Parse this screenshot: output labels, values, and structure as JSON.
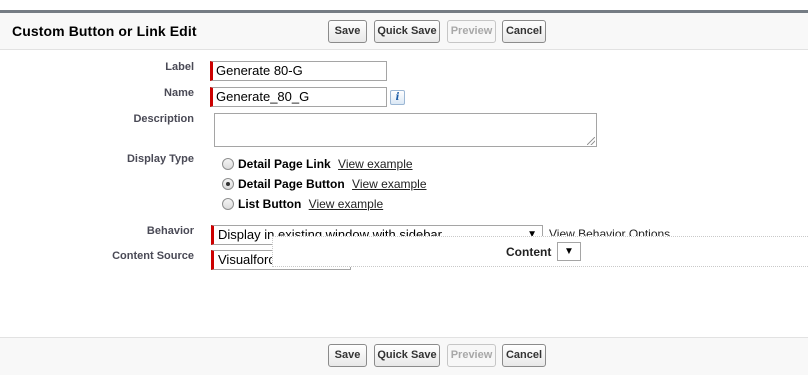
{
  "header": {
    "title": "Custom Button or Link Edit"
  },
  "buttons": {
    "save": "Save",
    "quick_save": "Quick Save",
    "preview": "Preview",
    "cancel": "Cancel"
  },
  "form": {
    "label": {
      "label": "Label",
      "value": "Generate 80-G"
    },
    "name": {
      "label": "Name",
      "value": "Generate_80_G",
      "info_icon": "info-icon"
    },
    "description": {
      "label": "Description",
      "value": ""
    },
    "display_type": {
      "label": "Display Type",
      "options": [
        {
          "label": "Detail Page Link",
          "link": "View example",
          "selected": false
        },
        {
          "label": "Detail Page Button",
          "link": "View example",
          "selected": true
        },
        {
          "label": "List Button",
          "link": "View example",
          "selected": false
        }
      ]
    },
    "behavior": {
      "label": "Behavior",
      "value": "Display in existing window with sidebar",
      "options_link": "View Behavior Options"
    },
    "content_source": {
      "label": "Content Source",
      "value": "Visualforce Page"
    },
    "content": {
      "label": "Content",
      "value": ""
    }
  },
  "colors": {
    "required_marker": "#cc0000",
    "header_border": "#757c84"
  }
}
